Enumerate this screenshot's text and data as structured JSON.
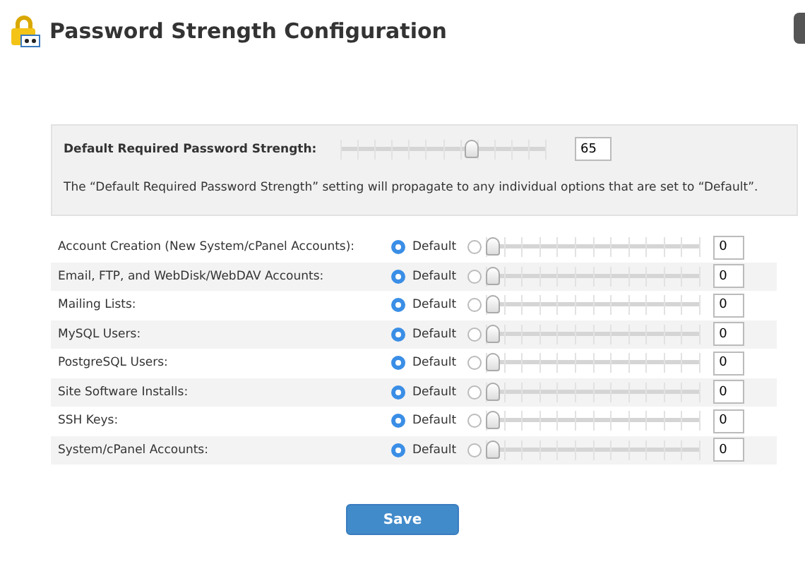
{
  "title": "Password Strength Configuration",
  "default_strength": {
    "label": "Default Required Password Strength:",
    "level": 0.65,
    "value": "65",
    "note": "The “Default Required Password Strength” setting will propagate to any individual options that are set to “Default”."
  },
  "options": [
    {
      "label": "Account Creation (New System/cPanel Accounts):",
      "default_label": "Default",
      "default_selected": true,
      "custom_selected": false,
      "level": 0,
      "value": "0"
    },
    {
      "label": "Email, FTP, and WebDisk/WebDAV Accounts:",
      "default_label": "Default",
      "default_selected": true,
      "custom_selected": false,
      "level": 0,
      "value": "0"
    },
    {
      "label": "Mailing Lists:",
      "default_label": "Default",
      "default_selected": true,
      "custom_selected": false,
      "level": 0,
      "value": "0"
    },
    {
      "label": "MySQL Users:",
      "default_label": "Default",
      "default_selected": true,
      "custom_selected": false,
      "level": 0,
      "value": "0"
    },
    {
      "label": "PostgreSQL Users:",
      "default_label": "Default",
      "default_selected": true,
      "custom_selected": false,
      "level": 0,
      "value": "0"
    },
    {
      "label": "Site Software Installs:",
      "default_label": "Default",
      "default_selected": true,
      "custom_selected": false,
      "level": 0,
      "value": "0"
    },
    {
      "label": "SSH Keys:",
      "default_label": "Default",
      "default_selected": true,
      "custom_selected": false,
      "level": 0,
      "value": "0"
    },
    {
      "label": "System/cPanel Accounts:",
      "default_label": "Default",
      "default_selected": true,
      "custom_selected": false,
      "level": 0,
      "value": "0"
    }
  ],
  "save_button": "Save"
}
